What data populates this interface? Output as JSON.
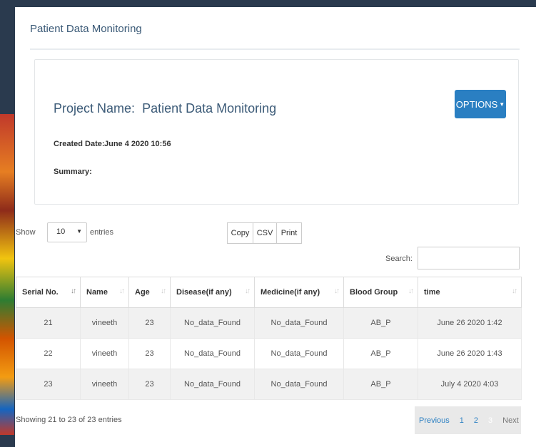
{
  "page": {
    "title": "Patient Data Monitoring"
  },
  "project": {
    "name_label": "Project Name:",
    "name_value": "Patient Data Monitoring",
    "options_label": "OPTIONS",
    "created_label": "Created Date:",
    "created_value": "June 4 2020 10:56",
    "summary_label": "Summary:"
  },
  "controls": {
    "show_label": "Show",
    "page_size": "10",
    "entries_label": "entries",
    "buttons": [
      "Copy",
      "CSV",
      "Print"
    ],
    "search_label": "Search:",
    "search_value": ""
  },
  "table": {
    "columns": [
      "Serial No.",
      "Name",
      "Age",
      "Disease(if any)",
      "Medicine(if any)",
      "Blood Group",
      "time"
    ],
    "rows": [
      [
        "21",
        "vineeth",
        "23",
        "No_data_Found",
        "No_data_Found",
        "AB_P",
        "June 26 2020 1:42"
      ],
      [
        "22",
        "vineeth",
        "23",
        "No_data_Found",
        "No_data_Found",
        "AB_P",
        "June 26 2020 1:43"
      ],
      [
        "23",
        "vineeth",
        "23",
        "No_data_Found",
        "No_data_Found",
        "AB_P",
        "July 4 2020 4:03"
      ]
    ]
  },
  "footer": {
    "info": "Showing 21 to 23 of 23 entries",
    "pagination": {
      "previous": "Previous",
      "pages": [
        "1",
        "2",
        "3"
      ],
      "next": "Next"
    }
  },
  "colors": {
    "accent": "#2a7fc2",
    "title": "#3b5a77",
    "stripe": "#f1f1f1"
  }
}
